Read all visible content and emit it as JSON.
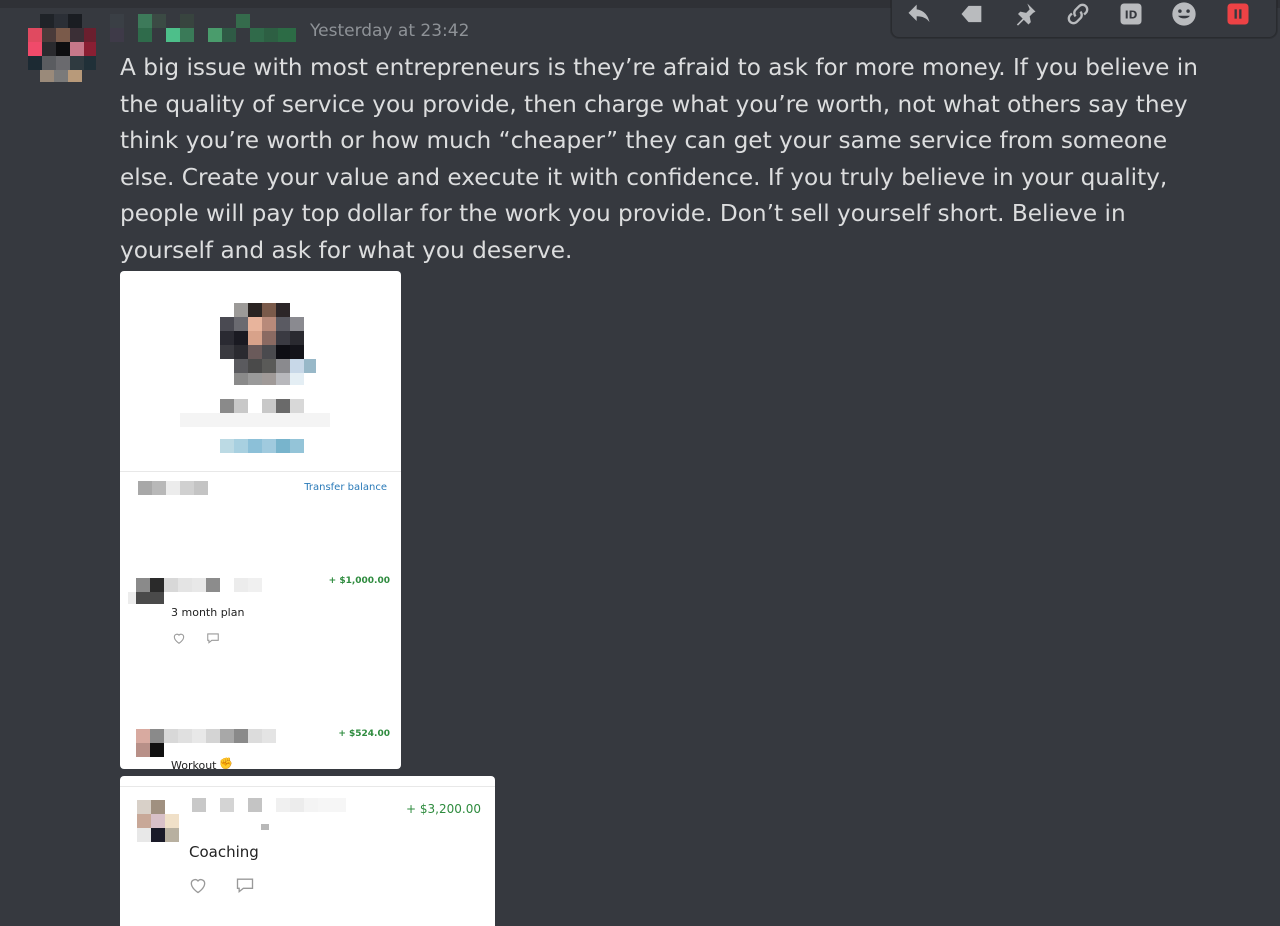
{
  "message": {
    "timestamp": "Yesterday at 23:42",
    "text": "A big issue with most entrepreneurs is they’re afraid to ask for more money. If you believe in the quality of service you provide, then charge what you’re worth, not what others say they think you’re worth or how much “cheaper” they can get your same service from someone else. Create your value and execute it with confidence. If you truly believe in your quality, people will pay top dollar for the work you provide. Don’t sell yourself short. Believe in yourself and ask for what you deserve."
  },
  "toolbar": {
    "icons": [
      "reply-icon",
      "tag-icon",
      "pin-icon",
      "link-icon",
      "id-icon",
      "emoji-icon",
      "delete-icon"
    ],
    "danger_color": "#ed4245"
  },
  "attachments": {
    "card1": {
      "transfer_label": "Transfer balance",
      "transactions": [
        {
          "amount": "+ $1,000.00",
          "note": "3 month plan"
        },
        {
          "amount": "+ $524.00",
          "note": "Workout"
        }
      ]
    },
    "card2": {
      "transaction": {
        "amount": "+ $3,200.00",
        "note": "Coaching"
      }
    }
  },
  "colors": {
    "background": "#36393f",
    "text": "#dcddde",
    "muted": "#8e9297",
    "amount_green": "#2e8b3e",
    "link_blue": "#2a7ab8"
  }
}
